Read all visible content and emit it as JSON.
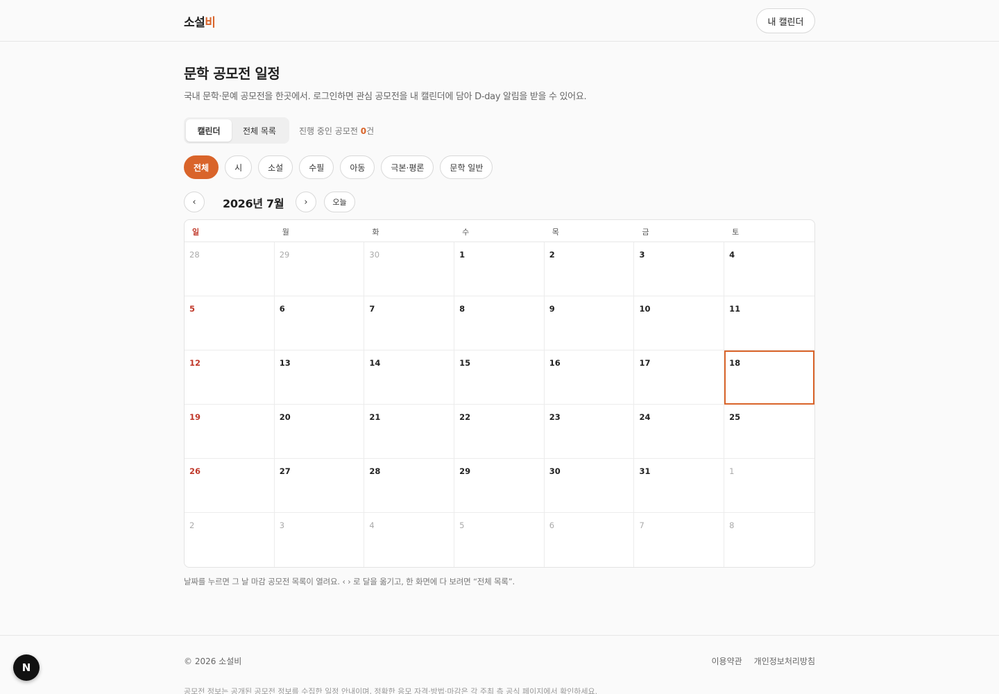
{
  "header": {
    "logo_main": "소설",
    "logo_accent": "비",
    "my_calendar_label": "내 캘린더"
  },
  "main": {
    "title": "문학 공모전 일정",
    "description": "국내 문학·문예 공모전을 한곳에서. 로그인하면 관심 공모전을 내 캘린더에 담아 D-day 알림을 받을 수 있어요.",
    "view_tabs": [
      {
        "label": "캘린더",
        "active": true
      },
      {
        "label": "전체 목록",
        "active": false
      }
    ],
    "ongoing_prefix": "진행 중인 공모전 ",
    "ongoing_count": "0",
    "ongoing_suffix": "건",
    "filters": [
      {
        "label": "전체",
        "active": true
      },
      {
        "label": "시",
        "active": false
      },
      {
        "label": "소설",
        "active": false
      },
      {
        "label": "수필",
        "active": false
      },
      {
        "label": "아동",
        "active": false
      },
      {
        "label": "극본·평론",
        "active": false
      },
      {
        "label": "문학 일반",
        "active": false
      }
    ],
    "month_nav": {
      "prev": "‹",
      "next": "›",
      "month_label": "2026년 7월",
      "today_label": "오늘"
    },
    "weekdays": [
      "일",
      "월",
      "화",
      "수",
      "목",
      "금",
      "토"
    ],
    "weeks": [
      [
        {
          "d": "28",
          "o": true
        },
        {
          "d": "29",
          "o": true
        },
        {
          "d": "30",
          "o": true
        },
        {
          "d": "1"
        },
        {
          "d": "2"
        },
        {
          "d": "3"
        },
        {
          "d": "4"
        }
      ],
      [
        {
          "d": "5"
        },
        {
          "d": "6"
        },
        {
          "d": "7"
        },
        {
          "d": "8"
        },
        {
          "d": "9"
        },
        {
          "d": "10"
        },
        {
          "d": "11"
        }
      ],
      [
        {
          "d": "12"
        },
        {
          "d": "13"
        },
        {
          "d": "14"
        },
        {
          "d": "15"
        },
        {
          "d": "16"
        },
        {
          "d": "17"
        },
        {
          "d": "18",
          "today": true
        }
      ],
      [
        {
          "d": "19"
        },
        {
          "d": "20"
        },
        {
          "d": "21"
        },
        {
          "d": "22"
        },
        {
          "d": "23"
        },
        {
          "d": "24"
        },
        {
          "d": "25"
        }
      ],
      [
        {
          "d": "26"
        },
        {
          "d": "27"
        },
        {
          "d": "28"
        },
        {
          "d": "29"
        },
        {
          "d": "30"
        },
        {
          "d": "31"
        },
        {
          "d": "1",
          "o": true
        }
      ],
      [
        {
          "d": "2",
          "o": true
        },
        {
          "d": "3",
          "o": true
        },
        {
          "d": "4",
          "o": true
        },
        {
          "d": "5",
          "o": true
        },
        {
          "d": "6",
          "o": true
        },
        {
          "d": "7",
          "o": true
        },
        {
          "d": "8",
          "o": true
        }
      ]
    ],
    "hint": "날짜를 누르면 그 날 마감 공모전 목록이 열려요. ‹ › 로 달을 옮기고, 한 화면에 다 보려면 “전체 목록”."
  },
  "footer": {
    "copyright": "© 2026 소설비",
    "terms": "이용약관",
    "privacy": "개인정보처리방침",
    "disclaimer": "공모전 정보는 공개된 공모전 정보를 수집한 일정 안내이며, 정확한 응모 자격·방법·마감은 각 주최 측 공식 페이지에서 확인하세요."
  },
  "badge": {
    "label": "N"
  },
  "colors": {
    "accent": "#d9642a",
    "sunday": "#c0392b"
  }
}
